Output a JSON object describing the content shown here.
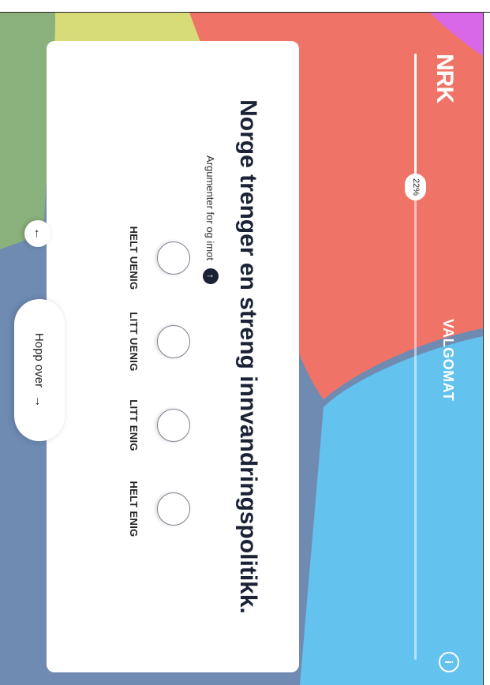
{
  "header": {
    "logo": "NRK",
    "title": "VALGOMAT",
    "info_icon": "info-icon"
  },
  "progress": {
    "percent": 22,
    "label": "22%"
  },
  "question": {
    "text": "Norge trenger en streng innvandringspolitikk.",
    "arguments_label": "Argumenter for og imot",
    "arguments_icon": "arrow-icon"
  },
  "options": [
    {
      "label": "HELT UENIG"
    },
    {
      "label": "LITT UENIG"
    },
    {
      "label": "LITT ENIG"
    },
    {
      "label": "HELT ENIG"
    }
  ],
  "nav": {
    "back_icon": "back-arrow-icon",
    "skip_label": "Hopp over"
  },
  "colors": {
    "coral": "#ef7467",
    "sky": "#63c2ee",
    "slate": "#6f8bb2",
    "green": "#8ab07b",
    "yellow": "#d7dc79",
    "magenta": "#d968e8",
    "text": "#1b2236"
  }
}
